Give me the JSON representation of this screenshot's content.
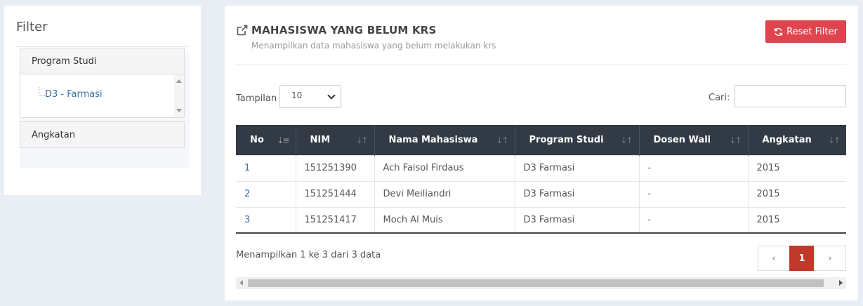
{
  "filter": {
    "title": "Filter",
    "sections": [
      {
        "label": "Program Studi",
        "items": [
          "D3 - Farmasi"
        ]
      },
      {
        "label": "Angkatan"
      }
    ]
  },
  "main": {
    "title": "MAHASISWA YANG BELUM KRS",
    "subtitle": "Menampilkan data mahasiswa yang belum melakukan krs",
    "reset_label": "Reset Filter",
    "length_label": "Tampilan",
    "length_value": "10",
    "search_label": "Cari:",
    "search_value": "",
    "columns": [
      "No",
      "NIM",
      "Nama Mahasiswa",
      "Program Studi",
      "Dosen Wali",
      "Angkatan"
    ],
    "rows": [
      [
        "1",
        "151251390",
        "Ach Faisol Firdaus",
        "D3 Farmasi",
        "-",
        "2015"
      ],
      [
        "2",
        "151251444",
        "Devi Meiliandri",
        "D3 Farmasi",
        "-",
        "2015"
      ],
      [
        "3",
        "151251417",
        "Moch Al Muis",
        "D3 Farmasi",
        "-",
        "2015"
      ]
    ],
    "info": "Menampilkan 1 ke 3 dari 3 data",
    "pagination": {
      "prev": "‹",
      "current": "1",
      "next": "›"
    }
  },
  "colors": {
    "reset_button": "#e0454f",
    "table_header": "#323a45",
    "active_page": "#c0392b",
    "link": "#3c6fa5"
  }
}
